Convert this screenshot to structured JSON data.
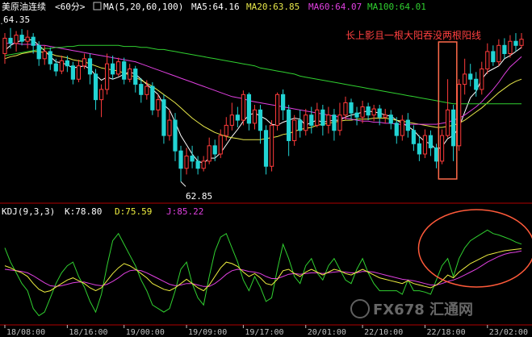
{
  "header": {
    "name": "美原油连续",
    "period": "<60分>",
    "ma_label": "MA(5,20,60,100)",
    "ma5": "MA5:64.16",
    "ma20": "MA20:63.85",
    "ma60": "MA60:64.07",
    "ma100": "MA100:64.01"
  },
  "kdj_header": {
    "label": "KDJ(9,3,3)",
    "k": "K:78.80",
    "d": "D:75.59",
    "j": "J:85.22"
  },
  "annotation": "长上影且一根大阳吞没两根阳线",
  "high_label": "64.35",
  "low_label": "62.85",
  "watermark": "FX678 汇通网",
  "colors": {
    "background": "#000000",
    "up": "#ff3b3b",
    "down": "#22d4d4",
    "ma5": "#ffffff",
    "ma20": "#e8e84a",
    "ma60": "#e040e0",
    "ma100": "#30d030",
    "k": "#ffffff",
    "d": "#f0f040",
    "j": "#e040e0",
    "annotation": "#ff4040",
    "axis": "#c0c0c0"
  },
  "chart_data": {
    "type": "candlestick",
    "price_range": [
      62.75,
      64.45
    ],
    "high": 64.35,
    "low": 62.85,
    "x_tick_labels": [
      "18/08:00",
      "18/16:00",
      "19/00:00",
      "19/09:00",
      "19/17:00",
      "20/01:00",
      "22/10:00",
      "22/18:00",
      "23/02:00"
    ],
    "candles": [
      [
        64.1,
        64.25,
        64.3,
        64.0
      ],
      [
        64.25,
        64.2,
        64.35,
        64.15
      ],
      [
        64.2,
        64.28,
        64.32,
        64.12
      ],
      [
        64.28,
        64.22,
        64.34,
        64.18
      ],
      [
        64.22,
        64.26,
        64.33,
        64.15
      ],
      [
        64.26,
        64.18,
        64.3,
        64.1
      ],
      [
        64.18,
        64.05,
        64.22,
        63.98
      ],
      [
        64.05,
        64.12,
        64.18,
        63.99
      ],
      [
        64.12,
        64.0,
        64.16,
        63.94
      ],
      [
        64.0,
        63.93,
        64.05,
        63.88
      ],
      [
        63.93,
        64.03,
        64.08,
        63.9
      ],
      [
        64.03,
        63.98,
        64.08,
        63.92
      ],
      [
        63.98,
        63.85,
        64.02,
        63.8
      ],
      [
        63.85,
        63.98,
        64.04,
        63.82
      ],
      [
        63.98,
        64.05,
        64.1,
        63.95
      ],
      [
        64.05,
        63.9,
        64.1,
        63.8
      ],
      [
        63.9,
        63.65,
        63.95,
        63.55
      ],
      [
        63.65,
        63.75,
        63.8,
        63.48
      ],
      [
        63.75,
        64.0,
        64.1,
        63.7
      ],
      [
        64.0,
        63.9,
        64.08,
        63.85
      ],
      [
        63.9,
        64.02,
        64.06,
        63.88
      ],
      [
        64.02,
        63.85,
        64.06,
        63.8
      ],
      [
        63.85,
        63.95,
        64.0,
        63.82
      ],
      [
        63.95,
        63.8,
        63.98,
        63.72
      ],
      [
        63.8,
        63.7,
        63.86,
        63.62
      ],
      [
        63.7,
        63.78,
        63.84,
        63.65
      ],
      [
        63.78,
        63.55,
        63.82,
        63.5
      ],
      [
        63.55,
        63.65,
        63.7,
        63.48
      ],
      [
        63.65,
        63.3,
        63.7,
        63.22
      ],
      [
        63.3,
        63.45,
        63.55,
        63.25
      ],
      [
        63.45,
        63.15,
        63.52,
        63.05
      ],
      [
        63.15,
        62.98,
        63.2,
        62.85
      ],
      [
        62.98,
        63.1,
        63.18,
        62.92
      ],
      [
        63.1,
        63.05,
        63.2,
        62.98
      ],
      [
        63.05,
        62.98,
        63.1,
        62.92
      ],
      [
        62.98,
        63.05,
        63.1,
        62.95
      ],
      [
        63.05,
        63.2,
        63.28,
        63.02
      ],
      [
        63.2,
        63.12,
        63.26,
        63.05
      ],
      [
        63.12,
        63.3,
        63.36,
        63.08
      ],
      [
        63.3,
        63.4,
        63.48,
        63.25
      ],
      [
        63.4,
        63.5,
        63.62,
        63.35
      ],
      [
        63.5,
        63.45,
        63.58,
        63.38
      ],
      [
        63.45,
        63.7,
        63.74,
        63.4
      ],
      [
        63.7,
        63.42,
        63.72,
        63.35
      ],
      [
        63.42,
        63.55,
        63.6,
        63.36
      ],
      [
        63.55,
        63.35,
        63.6,
        63.22
      ],
      [
        63.35,
        63.0,
        63.4,
        62.92
      ],
      [
        63.0,
        63.4,
        63.45,
        62.95
      ],
      [
        63.4,
        63.7,
        63.72,
        63.35
      ],
      [
        63.7,
        63.55,
        63.75,
        63.45
      ],
      [
        63.55,
        63.25,
        63.6,
        63.1
      ],
      [
        63.25,
        63.45,
        63.5,
        63.2
      ],
      [
        63.45,
        63.35,
        63.55,
        63.28
      ],
      [
        63.35,
        63.5,
        63.56,
        63.3
      ],
      [
        63.5,
        63.4,
        63.58,
        63.32
      ],
      [
        63.4,
        63.55,
        63.62,
        63.38
      ],
      [
        63.55,
        63.4,
        63.6,
        63.3
      ],
      [
        63.4,
        63.5,
        63.58,
        63.32
      ],
      [
        63.5,
        63.35,
        63.56,
        63.25
      ],
      [
        63.35,
        63.5,
        63.62,
        63.3
      ],
      [
        63.5,
        63.62,
        63.68,
        63.45
      ],
      [
        63.62,
        63.52,
        63.66,
        63.46
      ],
      [
        63.52,
        63.48,
        63.58,
        63.4
      ],
      [
        63.48,
        63.58,
        63.64,
        63.42
      ],
      [
        63.58,
        63.5,
        63.62,
        63.45
      ],
      [
        63.5,
        63.56,
        63.6,
        63.44
      ],
      [
        63.56,
        63.48,
        63.6,
        63.4
      ],
      [
        63.48,
        63.5,
        63.56,
        63.42
      ],
      [
        63.5,
        63.42,
        63.55,
        63.36
      ],
      [
        63.42,
        63.3,
        63.48,
        63.22
      ],
      [
        63.3,
        63.45,
        63.5,
        63.25
      ],
      [
        63.45,
        63.35,
        63.52,
        63.28
      ],
      [
        63.35,
        63.22,
        63.4,
        63.15
      ],
      [
        63.22,
        63.12,
        63.3,
        63.05
      ],
      [
        63.12,
        63.3,
        63.36,
        63.08
      ],
      [
        63.3,
        63.18,
        63.35,
        63.1
      ],
      [
        63.18,
        63.05,
        63.22,
        62.98
      ],
      [
        63.05,
        63.3,
        63.36,
        63.02
      ],
      [
        63.3,
        63.55,
        63.85,
        63.28
      ],
      [
        63.55,
        63.2,
        63.6,
        63.05
      ],
      [
        63.2,
        63.8,
        63.85,
        63.15
      ],
      [
        63.8,
        63.9,
        64.05,
        63.7
      ],
      [
        63.9,
        63.85,
        64.0,
        63.78
      ],
      [
        63.85,
        63.75,
        63.92,
        63.68
      ],
      [
        63.75,
        63.95,
        64.02,
        63.7
      ],
      [
        63.95,
        64.12,
        64.2,
        63.9
      ],
      [
        64.12,
        64.02,
        64.18,
        63.98
      ],
      [
        64.02,
        64.18,
        64.24,
        63.98
      ],
      [
        64.18,
        64.1,
        64.25,
        64.05
      ],
      [
        64.1,
        64.22,
        64.28,
        64.06
      ],
      [
        64.22,
        64.18,
        64.3,
        64.12
      ],
      [
        64.18,
        64.24,
        64.3,
        64.15
      ]
    ],
    "series": [
      {
        "name": "MA5",
        "values": [
          64.13,
          64.18,
          64.21,
          64.23,
          64.24,
          64.23,
          64.18,
          64.13,
          64.07,
          64.02,
          64.01,
          63.99,
          63.96,
          63.97,
          63.98,
          63.95,
          63.89,
          63.84,
          63.87,
          63.85,
          63.87,
          63.9,
          63.92,
          63.9,
          63.85,
          63.8,
          63.75,
          63.7,
          63.6,
          63.55,
          63.43,
          63.3,
          63.21,
          63.12,
          63.05,
          63.03,
          63.08,
          63.08,
          63.13,
          63.21,
          63.29,
          63.36,
          63.44,
          63.5,
          63.52,
          63.49,
          63.46,
          63.41,
          63.4,
          63.43,
          63.45,
          63.47,
          63.46,
          63.4,
          63.43,
          63.45,
          63.43,
          63.44,
          63.45,
          63.45,
          63.48,
          63.5,
          63.51,
          63.53,
          63.54,
          63.53,
          63.52,
          63.5,
          63.49,
          63.45,
          63.42,
          63.39,
          63.35,
          63.29,
          63.24,
          63.22,
          63.16,
          63.19,
          63.27,
          63.3,
          63.38,
          63.53,
          63.67,
          63.73,
          63.85,
          63.92,
          63.95,
          63.98,
          64.05,
          64.08,
          64.12,
          64.16
        ]
      },
      {
        "name": "MA20",
        "values": [
          64.05,
          64.07,
          64.08,
          64.1,
          64.11,
          64.12,
          64.12,
          64.11,
          64.1,
          64.08,
          64.07,
          64.06,
          64.04,
          64.03,
          64.02,
          64.0,
          63.98,
          63.96,
          63.95,
          63.94,
          63.93,
          63.91,
          63.89,
          63.87,
          63.84,
          63.81,
          63.78,
          63.74,
          63.7,
          63.66,
          63.62,
          63.57,
          63.52,
          63.47,
          63.43,
          63.39,
          63.36,
          63.33,
          63.31,
          63.29,
          63.28,
          63.27,
          63.26,
          63.26,
          63.26,
          63.26,
          63.27,
          63.28,
          63.29,
          63.31,
          63.32,
          63.34,
          63.36,
          63.37,
          63.38,
          63.4,
          63.41,
          63.42,
          63.43,
          63.44,
          63.45,
          63.45,
          63.46,
          63.46,
          63.46,
          63.47,
          63.47,
          63.47,
          63.46,
          63.45,
          63.44,
          63.43,
          63.42,
          63.41,
          63.4,
          63.39,
          63.38,
          63.38,
          63.39,
          63.4,
          63.42,
          63.45,
          63.49,
          63.53,
          63.57,
          63.62,
          63.67,
          63.72,
          63.76,
          63.8,
          63.83,
          63.85
        ]
      },
      {
        "name": "MA60",
        "values": [
          64.2,
          64.2,
          64.2,
          64.19,
          64.19,
          64.19,
          64.18,
          64.18,
          64.17,
          64.16,
          64.15,
          64.14,
          64.13,
          64.12,
          64.11,
          64.1,
          64.09,
          64.08,
          64.07,
          64.06,
          64.05,
          64.04,
          64.03,
          64.02,
          64.0,
          63.98,
          63.96,
          63.94,
          63.92,
          63.9,
          63.88,
          63.86,
          63.84,
          63.82,
          63.8,
          63.78,
          63.76,
          63.74,
          63.72,
          63.7,
          63.68,
          63.67,
          63.66,
          63.64,
          63.63,
          63.62,
          63.61,
          63.6,
          63.59,
          63.58,
          63.57,
          63.56,
          63.55,
          63.54,
          63.53,
          63.52,
          63.51,
          63.5,
          63.49,
          63.48,
          63.47,
          63.46,
          63.45,
          63.44,
          63.44,
          63.43,
          63.43,
          63.42,
          63.42,
          63.41,
          63.41,
          63.41,
          63.41,
          63.41,
          63.41,
          63.41,
          63.41,
          63.42,
          63.43,
          63.45,
          63.47,
          63.5,
          63.54,
          63.58,
          63.63,
          63.69,
          63.75,
          63.82,
          63.9,
          63.97,
          64.02,
          64.07
        ]
      },
      {
        "name": "MA100",
        "values": [
          64.08,
          64.09,
          64.1,
          64.11,
          64.12,
          64.13,
          64.14,
          64.15,
          64.15,
          64.16,
          64.16,
          64.17,
          64.17,
          64.18,
          64.18,
          64.18,
          64.18,
          64.18,
          64.18,
          64.18,
          64.18,
          64.17,
          64.17,
          64.17,
          64.16,
          64.16,
          64.15,
          64.14,
          64.14,
          64.13,
          64.12,
          64.11,
          64.1,
          64.09,
          64.08,
          64.07,
          64.06,
          64.05,
          64.04,
          64.03,
          64.02,
          64.01,
          64.0,
          63.99,
          63.98,
          63.96,
          63.95,
          63.94,
          63.93,
          63.92,
          63.91,
          63.9,
          63.88,
          63.87,
          63.86,
          63.85,
          63.84,
          63.83,
          63.82,
          63.81,
          63.8,
          63.79,
          63.78,
          63.77,
          63.76,
          63.75,
          63.74,
          63.73,
          63.72,
          63.71,
          63.7,
          63.69,
          63.68,
          63.67,
          63.66,
          63.65,
          63.64,
          63.63,
          63.62,
          63.61,
          63.61,
          63.61,
          63.61,
          63.61,
          63.61,
          63.61,
          63.61,
          63.61,
          63.61,
          63.61,
          63.61,
          63.61
        ]
      }
    ],
    "kdj": {
      "range": [
        -20,
        120
      ],
      "K": [
        55,
        52,
        48,
        45,
        40,
        30,
        22,
        18,
        20,
        25,
        30,
        35,
        38,
        34,
        30,
        24,
        20,
        24,
        34,
        44,
        52,
        58,
        55,
        50,
        44,
        38,
        30,
        26,
        22,
        20,
        24,
        30,
        36,
        30,
        24,
        20,
        28,
        40,
        52,
        60,
        58,
        54,
        46,
        40,
        44,
        38,
        30,
        28,
        36,
        48,
        50,
        44,
        40,
        46,
        50,
        46,
        42,
        46,
        50,
        48,
        44,
        42,
        46,
        50,
        46,
        42,
        38,
        36,
        34,
        32,
        30,
        34,
        30,
        28,
        26,
        24,
        28,
        34,
        42,
        38,
        46,
        52,
        58,
        62,
        66,
        70,
        72,
        74,
        76,
        77,
        78,
        78.8
      ],
      "D": [
        50,
        49,
        48,
        47,
        45,
        41,
        36,
        31,
        27,
        26,
        27,
        29,
        31,
        32,
        32,
        30,
        28,
        27,
        29,
        33,
        38,
        44,
        48,
        49,
        48,
        45,
        41,
        37,
        33,
        29,
        27,
        28,
        30,
        30,
        28,
        26,
        26,
        30,
        36,
        43,
        48,
        50,
        49,
        47,
        46,
        44,
        40,
        37,
        37,
        40,
        43,
        44,
        43,
        44,
        45,
        45,
        44,
        45,
        46,
        47,
        46,
        45,
        45,
        47,
        47,
        46,
        44,
        42,
        40,
        38,
        36,
        35,
        34,
        32,
        30,
        28,
        28,
        30,
        33,
        35,
        38,
        42,
        46,
        50,
        55,
        60,
        64,
        68,
        71,
        73,
        74,
        75.59
      ],
      "J": [
        80,
        60,
        45,
        30,
        20,
        -5,
        -15,
        -10,
        10,
        30,
        45,
        55,
        60,
        40,
        25,
        5,
        -10,
        15,
        55,
        90,
        100,
        85,
        70,
        55,
        35,
        20,
        0,
        -5,
        -10,
        -5,
        20,
        50,
        60,
        30,
        10,
        0,
        40,
        75,
        95,
        100,
        80,
        60,
        35,
        20,
        40,
        25,
        5,
        10,
        50,
        85,
        65,
        40,
        30,
        55,
        65,
        45,
        35,
        55,
        65,
        50,
        35,
        30,
        50,
        65,
        45,
        30,
        20,
        20,
        20,
        20,
        15,
        35,
        20,
        20,
        18,
        15,
        35,
        55,
        65,
        40,
        65,
        80,
        90,
        95,
        100,
        105,
        100,
        98,
        95,
        92,
        88,
        85.22
      ]
    }
  }
}
